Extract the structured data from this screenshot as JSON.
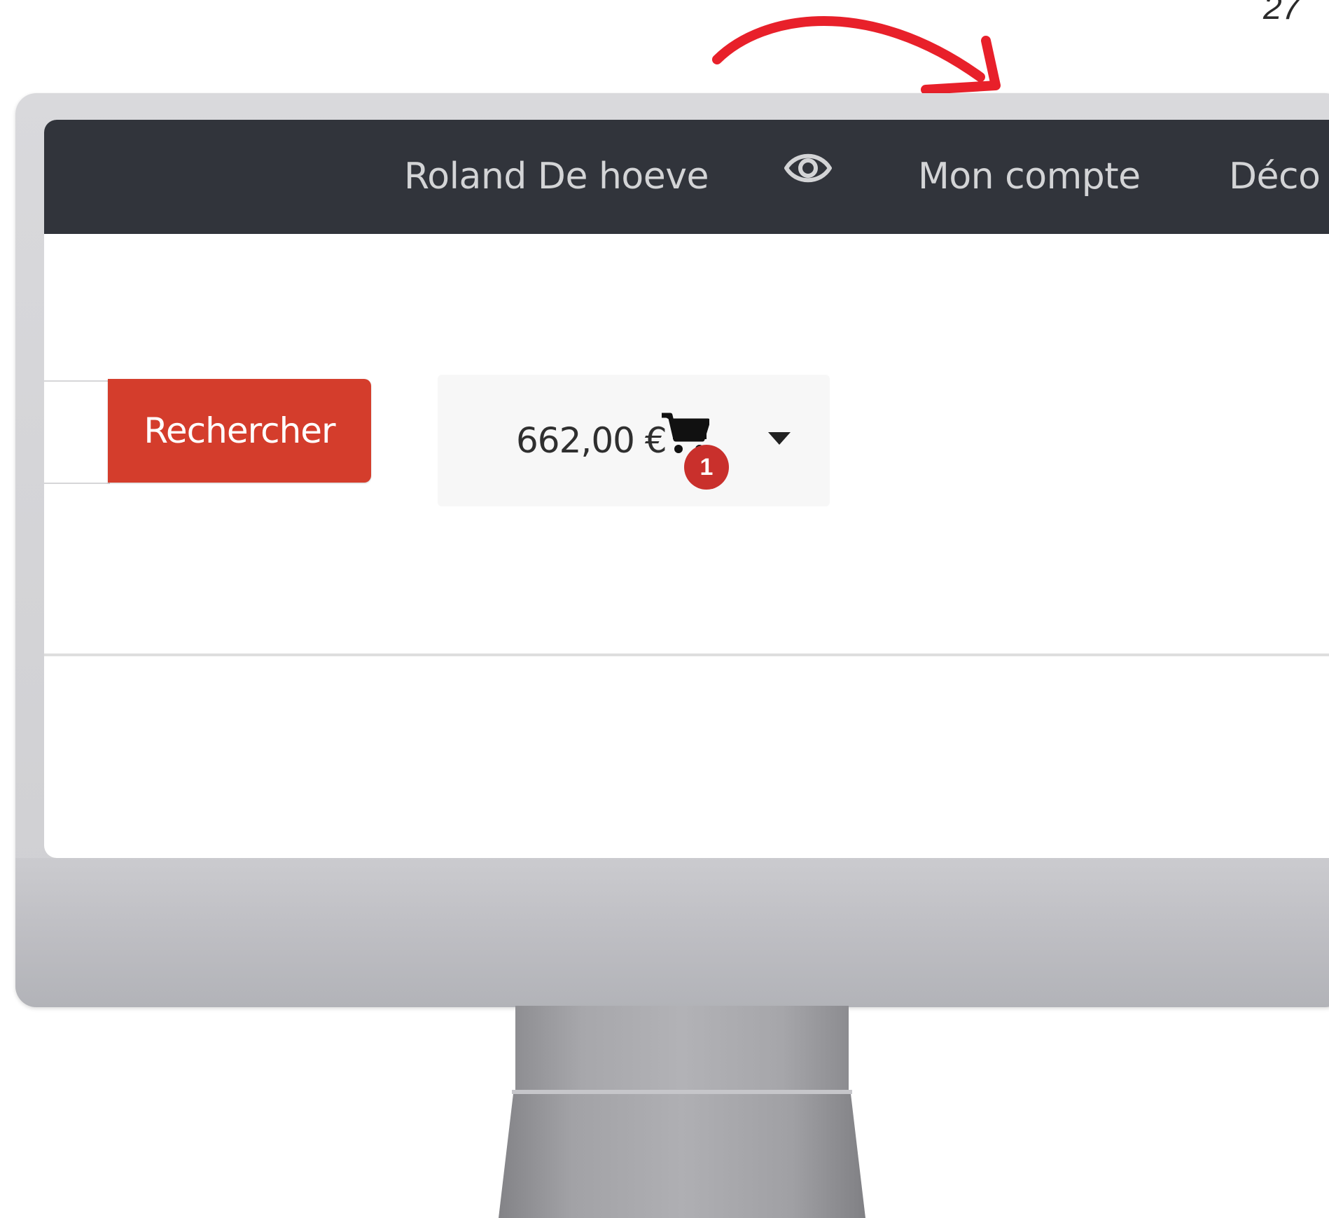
{
  "page_number": "27",
  "navbar": {
    "user_name": "Roland De hoeve",
    "eye_icon": "eye-icon",
    "account_label": "Mon compte",
    "logout_label_visible": "Déco"
  },
  "search": {
    "button_label": "Rechercher"
  },
  "cart": {
    "total": "662,00 €",
    "item_count": "1",
    "icon": "shopping-cart-icon",
    "dropdown_icon": "caret-down-icon"
  },
  "colors": {
    "navbar_bg": "#31343b",
    "search_button_bg": "#d43d2c",
    "badge_bg": "#c9302c",
    "annotation_arrow": "#e8202a"
  }
}
